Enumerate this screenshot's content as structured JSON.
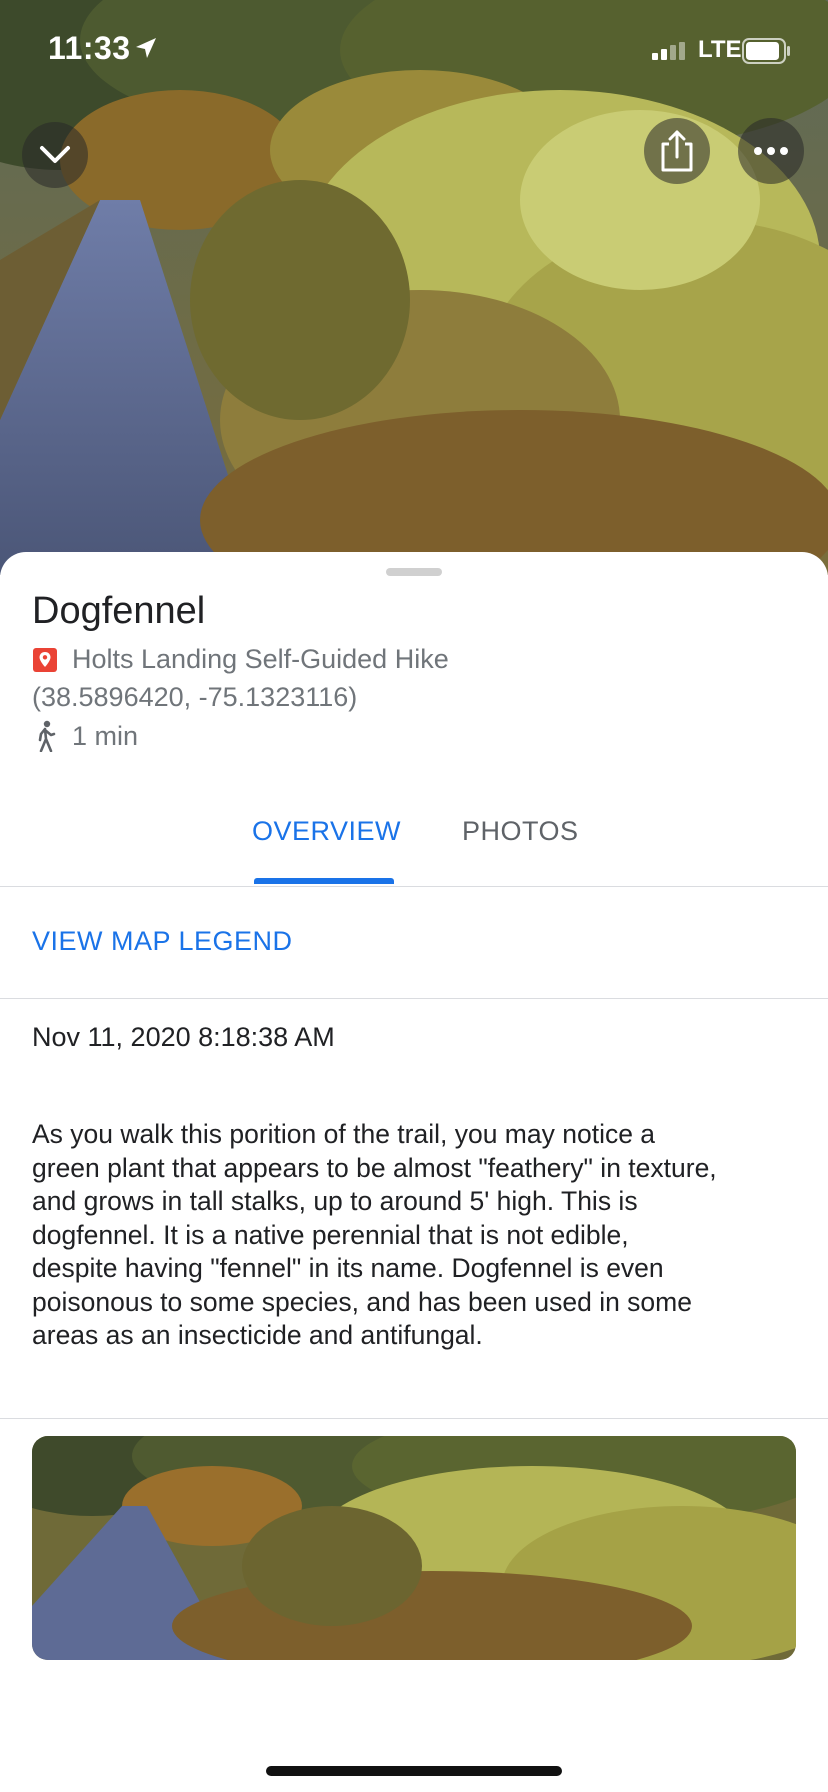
{
  "status_bar": {
    "time": "11:33",
    "carrier": "LTE"
  },
  "icons": {
    "collapse": "chevron-down-icon",
    "share": "share-icon",
    "more": "more-horizontal-icon",
    "pin": "map-pin-icon",
    "walk": "walking-person-icon"
  },
  "place": {
    "title": "Dogfennel",
    "trail": "Holts Landing Self-Guided Hike",
    "coordinates": "(38.5896420, -75.1323116)",
    "walk_time": "1 min"
  },
  "tabs": [
    {
      "label": "OVERVIEW",
      "selected": true
    },
    {
      "label": "PHOTOS",
      "selected": false
    }
  ],
  "legend": {
    "label": "VIEW MAP LEGEND"
  },
  "timestamp": "Nov 11, 2020 8:18:38 AM",
  "description": "As you walk this porition of the trail, you may notice a\ngreen plant that appears to be almost \"feathery\" in texture,\nand grows in tall stalks, up to around 5' high.  This is\ndogfennel.  It is a native perennial that is not edible,\ndespite having \"fennel\" in its name.  Dogfennel is even\npoisonous to some species, and has been used in some\nareas as an insecticide and antifungal.",
  "colors": {
    "accent": "#1a73e8",
    "pin": "#ea4335",
    "secondary_text": "#70757a"
  }
}
